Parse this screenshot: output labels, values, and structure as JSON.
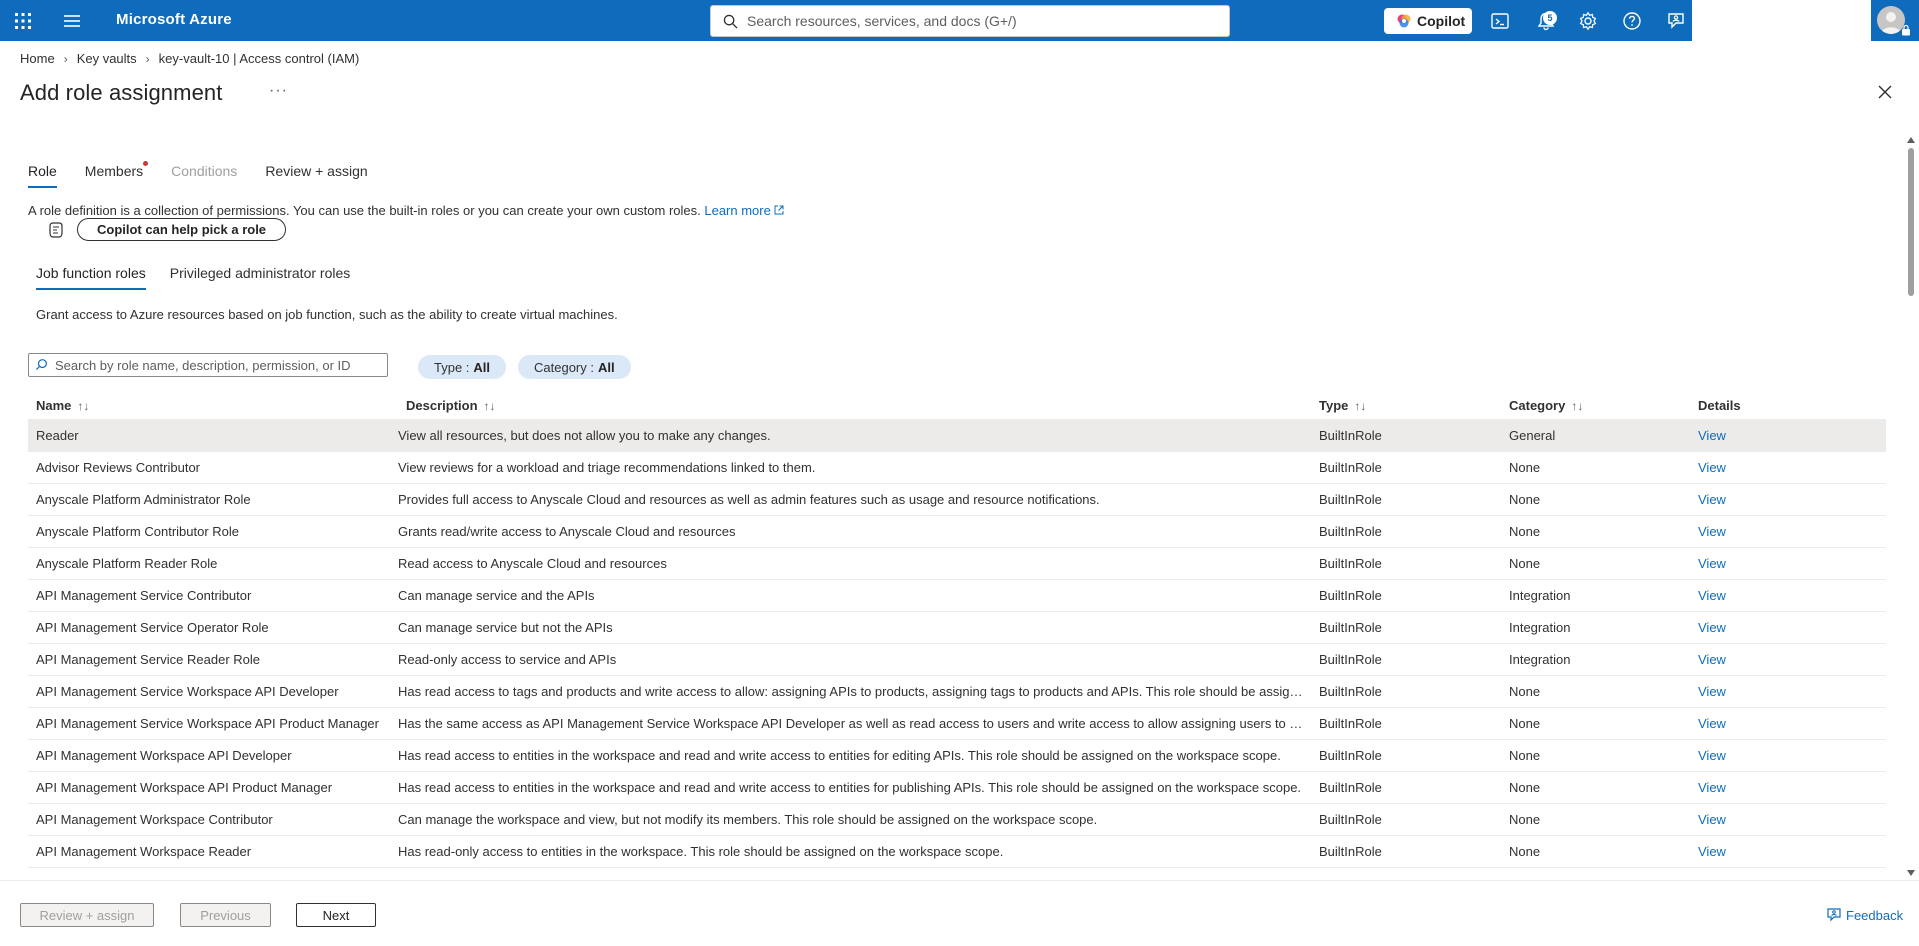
{
  "topbar": {
    "brand": "Microsoft Azure",
    "search_placeholder": "Search resources, services, and docs (G+/)",
    "copilot_label": "Copilot",
    "notification_count": "5"
  },
  "breadcrumb": [
    "Home",
    "Key vaults",
    "key-vault-10 | Access control (IAM)"
  ],
  "page": {
    "title": "Add role assignment",
    "more": "···"
  },
  "wizard_tabs": [
    {
      "label": "Role",
      "state": "active"
    },
    {
      "label": "Members",
      "state": "dot"
    },
    {
      "label": "Conditions",
      "state": "disabled"
    },
    {
      "label": "Review + assign",
      "state": "normal"
    }
  ],
  "intro": {
    "text": "A role definition is a collection of permissions. You can use the built-in roles or you can create your own custom roles. ",
    "learn_more": "Learn more"
  },
  "copilot_pick_label": "Copilot can help pick a role",
  "sub_tabs": [
    "Job function roles",
    "Privileged administrator roles"
  ],
  "sub_description": "Grant access to Azure resources based on job function, such as the ability to create virtual machines.",
  "filters": {
    "search_placeholder": "Search by role name, description, permission, or ID",
    "type_label": "Type :",
    "type_value": "All",
    "category_label": "Category :",
    "category_value": "All"
  },
  "table": {
    "headers": {
      "name": "Name",
      "description": "Description",
      "type": "Type",
      "category": "Category",
      "details": "Details"
    },
    "rows": [
      {
        "name": "Reader",
        "description": "View all resources, but does not allow you to make any changes.",
        "type": "BuiltInRole",
        "category": "General",
        "details": "View"
      },
      {
        "name": "Advisor Reviews Contributor",
        "description": "View reviews for a workload and triage recommendations linked to them.",
        "type": "BuiltInRole",
        "category": "None",
        "details": "View"
      },
      {
        "name": "Anyscale Platform Administrator Role",
        "description": "Provides full access to Anyscale Cloud and resources as well as admin features such as usage and resource notifications.",
        "type": "BuiltInRole",
        "category": "None",
        "details": "View"
      },
      {
        "name": "Anyscale Platform Contributor Role",
        "description": "Grants read/write access to Anyscale Cloud and resources",
        "type": "BuiltInRole",
        "category": "None",
        "details": "View"
      },
      {
        "name": "Anyscale Platform Reader Role",
        "description": "Read access to Anyscale Cloud and resources",
        "type": "BuiltInRole",
        "category": "None",
        "details": "View"
      },
      {
        "name": "API Management Service Contributor",
        "description": "Can manage service and the APIs",
        "type": "BuiltInRole",
        "category": "Integration",
        "details": "View"
      },
      {
        "name": "API Management Service Operator Role",
        "description": "Can manage service but not the APIs",
        "type": "BuiltInRole",
        "category": "Integration",
        "details": "View"
      },
      {
        "name": "API Management Service Reader Role",
        "description": "Read-only access to service and APIs",
        "type": "BuiltInRole",
        "category": "Integration",
        "details": "View"
      },
      {
        "name": "API Management Service Workspace API Developer",
        "description": "Has read access to tags and products and write access to allow: assigning APIs to products, assigning tags to products and APIs. This role should be assigne...",
        "type": "BuiltInRole",
        "category": "None",
        "details": "View"
      },
      {
        "name": "API Management Service Workspace API Product Manager",
        "description": "Has the same access as API Management Service Workspace API Developer as well as read access to users and write access to allow assigning users to grou...",
        "type": "BuiltInRole",
        "category": "None",
        "details": "View"
      },
      {
        "name": "API Management Workspace API Developer",
        "description": "Has read access to entities in the workspace and read and write access to entities for editing APIs. This role should be assigned on the workspace scope.",
        "type": "BuiltInRole",
        "category": "None",
        "details": "View"
      },
      {
        "name": "API Management Workspace API Product Manager",
        "description": "Has read access to entities in the workspace and read and write access to entities for publishing APIs. This role should be assigned on the workspace scope.",
        "type": "BuiltInRole",
        "category": "None",
        "details": "View"
      },
      {
        "name": "API Management Workspace Contributor",
        "description": "Can manage the workspace and view, but not modify its members. This role should be assigned on the workspace scope.",
        "type": "BuiltInRole",
        "category": "None",
        "details": "View"
      },
      {
        "name": "API Management Workspace Reader",
        "description": "Has read-only access to entities in the workspace. This role should be assigned on the workspace scope.",
        "type": "BuiltInRole",
        "category": "None",
        "details": "View"
      }
    ]
  },
  "footer": {
    "review_assign": "Review + assign",
    "previous": "Previous",
    "next": "Next",
    "feedback": "Feedback"
  }
}
